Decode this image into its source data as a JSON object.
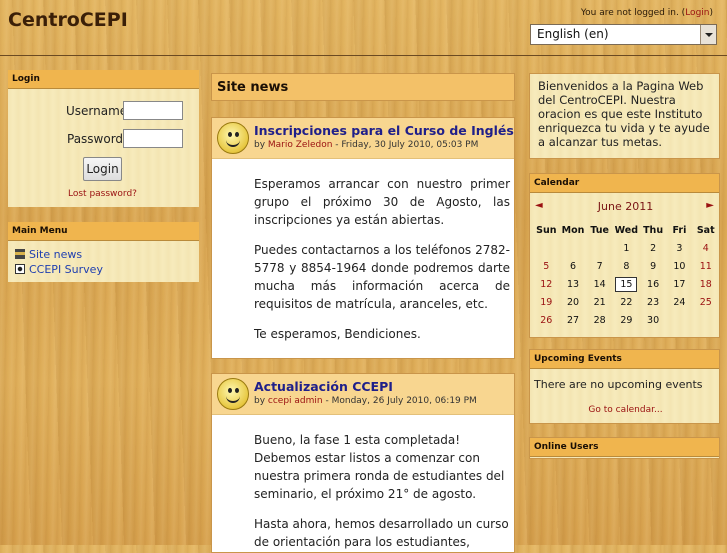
{
  "header": {
    "title": "CentroCEPI",
    "login_status": "You are not logged in. (",
    "login_link": "Login",
    "login_close": ")",
    "language": "English (en)"
  },
  "login_block": {
    "title": "Login",
    "username_label": "Username",
    "password_label": "Password",
    "button": "Login",
    "lost_password": "Lost password?"
  },
  "main_menu": {
    "title": "Main Menu",
    "items": [
      {
        "label": "Site news",
        "icon": "forum-icon"
      },
      {
        "label": "CCEPI Survey",
        "icon": "survey-icon"
      }
    ]
  },
  "site_news": {
    "title": "Site news",
    "posts": [
      {
        "title": "Inscripciones para el Curso de Inglés",
        "by": "by ",
        "author": "Mario Zeledon",
        "date": " - Friday, 30 July 2010, 05:03 PM",
        "paragraphs": [
          "Esperamos arrancar con nuestro primer grupo el próximo 30 de Agosto, las inscripciones ya están abiertas.",
          "Puedes contactarnos a los teléfonos 2782-5778 y 8854-1964 donde podremos darte mucha más información acerca de requisitos de matrícula, aranceles, etc.",
          "Te esperamos, Bendiciones."
        ]
      },
      {
        "title": "Actualización CCEPI",
        "by": "by ",
        "author": "ccepi admin",
        "date": " - Monday, 26 July 2010, 06:19 PM",
        "paragraphs": [
          "Bueno, la fase 1 esta completada! Debemos estar listos a comenzar con nuestra primera ronda de estudiantes del seminario, el próximo 21° de agosto.",
          "Hasta ahora, hemos desarrollado un curso de orientación para los estudiantes,"
        ]
      }
    ]
  },
  "intro": {
    "text": "Bienvenidos a la Pagina Web del CentroCEPI. Nuestra oracion es que este Instituto enriquezca tu vida y te ayude a alcanzar tus metas."
  },
  "calendar": {
    "title": "Calendar",
    "month": "June 2011",
    "prev": "◄",
    "next": "►",
    "weekdays": [
      "Sun",
      "Mon",
      "Tue",
      "Wed",
      "Thu",
      "Fri",
      "Sat"
    ],
    "weeks": [
      [
        "",
        "",
        "",
        "1",
        "2",
        "3",
        "4"
      ],
      [
        "5",
        "6",
        "7",
        "8",
        "9",
        "10",
        "11"
      ],
      [
        "12",
        "13",
        "14",
        "15",
        "16",
        "17",
        "18"
      ],
      [
        "19",
        "20",
        "21",
        "22",
        "23",
        "24",
        "25"
      ],
      [
        "26",
        "27",
        "28",
        "29",
        "30",
        "",
        ""
      ]
    ],
    "today": "15"
  },
  "upcoming": {
    "title": "Upcoming Events",
    "none": "There are no upcoming events",
    "goto": "Go to calendar..."
  },
  "online": {
    "title": "Online Users"
  }
}
